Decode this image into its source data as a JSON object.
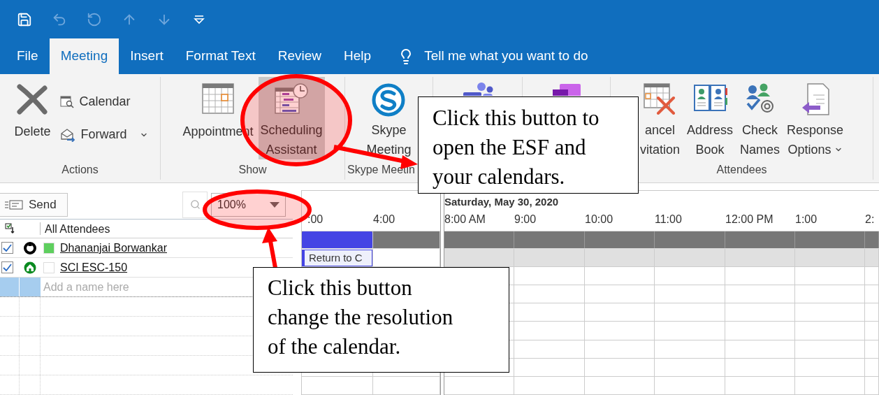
{
  "quick_access": [
    {
      "disabled": false
    },
    {
      "disabled": true
    },
    {
      "disabled": true
    },
    {
      "disabled": true
    },
    {
      "disabled": true
    },
    {
      "disabled": false
    }
  ],
  "tabs": [
    {
      "label": "File",
      "selected": false
    },
    {
      "label": "Meeting",
      "selected": true
    },
    {
      "label": "Insert",
      "selected": false
    },
    {
      "label": "Format Text",
      "selected": false
    },
    {
      "label": "Review",
      "selected": false
    },
    {
      "label": "Help",
      "selected": false
    }
  ],
  "tell_me": "Tell me what you want to do",
  "ribbon": [
    {
      "label": "Actions",
      "items": [
        {
          "kind": "large",
          "lines": [
            "Delete"
          ],
          "selected": false,
          "dropdown": false
        },
        {
          "kind": "stack",
          "buttons": [
            {
              "label": "Calendar",
              "dropdown": false
            },
            {
              "label": "Forward",
              "dropdown": true
            }
          ]
        }
      ]
    },
    {
      "label": "Show",
      "items": [
        {
          "kind": "large",
          "lines": [
            "Appointment"
          ],
          "selected": false,
          "dropdown": false
        },
        {
          "kind": "large",
          "lines": [
            "Scheduling",
            "Assistant"
          ],
          "selected": true,
          "dropdown": false
        }
      ]
    },
    {
      "label": "Skype Meetin",
      "items": [
        {
          "kind": "large",
          "lines": [
            "Skype",
            "Meeting"
          ],
          "selected": false,
          "dropdown": false
        }
      ]
    },
    {
      "items": [
        {
          "kind": "large",
          "selected": false
        }
      ]
    },
    {
      "items": [
        {
          "kind": "large",
          "selected": false
        }
      ]
    },
    {
      "label": "Attendees",
      "items": [
        {
          "kind": "large",
          "lines": [
            "ancel",
            "vitation"
          ],
          "selected": false,
          "dropdown": false
        },
        {
          "kind": "large",
          "lines": [
            "Address",
            "Book"
          ],
          "selected": false,
          "dropdown": false
        },
        {
          "kind": "large",
          "lines": [
            "Check",
            "Names"
          ],
          "selected": false,
          "dropdown": false
        },
        {
          "kind": "large",
          "lines": [
            "Response",
            "Options"
          ],
          "selected": false,
          "dropdown": true
        }
      ]
    }
  ],
  "scheduler": {
    "send": "Send",
    "zoom": "100%",
    "header": "All Attendees",
    "attendees": [
      {
        "checked": true,
        "kind": "organizer",
        "color": "#5ecf5e",
        "name": "Dhananjai Borwankar"
      },
      {
        "checked": true,
        "kind": "room",
        "color": "#ffffff",
        "name": "SCI ESC-150"
      }
    ],
    "add_placeholder": "Add a name here",
    "date": "Saturday, May 30, 2020",
    "left_hours": [
      ":00",
      "4:00"
    ],
    "right_hours": [
      "8:00 AM",
      "9:00",
      "10:00",
      "11:00",
      "12:00 PM",
      "1:00",
      "2:"
    ],
    "blocks": [
      {
        "kind": "busy"
      },
      {
        "kind": "appointment",
        "label": "Return to C"
      }
    ]
  },
  "callouts": [
    {
      "text": "Click this button to open the ESF and your calendars."
    },
    {
      "text": "Click this button change the resolution of the calendar."
    }
  ]
}
